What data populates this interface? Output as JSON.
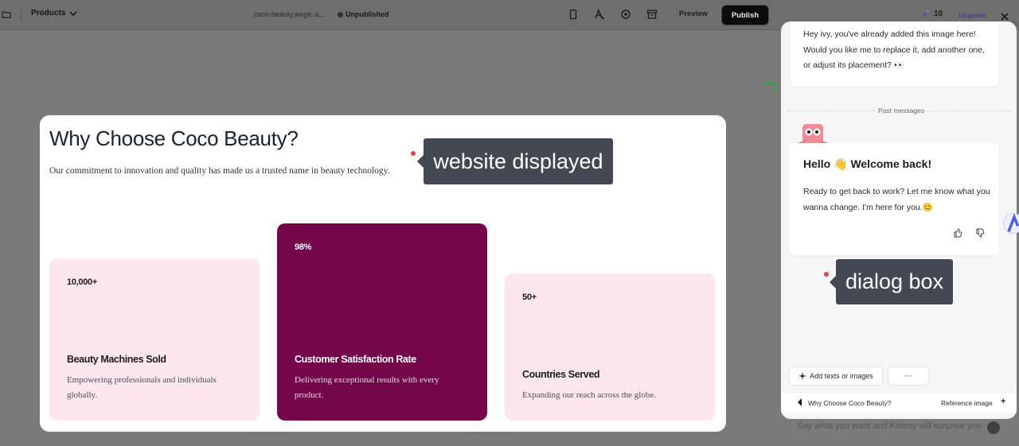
{
  "topbar": {
    "pages_label": "Products",
    "site_url": "coco-beauty.wegic.a...",
    "status": "Unpublished",
    "preview_label": "Preview",
    "publish_label": "Publish",
    "credits": "10",
    "upgrade_label": "Upgrade",
    "tool_icons": [
      "mobile-icon",
      "text-style-icon",
      "settings-icon",
      "archive-icon"
    ]
  },
  "site": {
    "heading": "Why Choose Coco Beauty?",
    "subheading": "Our commitment to innovation and quality has made us a trusted name in beauty technology.",
    "cards": [
      {
        "number": "10,000+",
        "title": "Beauty Machines Sold",
        "description": "Empowering professionals and individuals globally.",
        "style": "light"
      },
      {
        "number": "98%",
        "title": "Customer Satisfaction Rate",
        "description": "Delivering exceptional results with every product.",
        "style": "dark"
      },
      {
        "number": "50+",
        "title": "Countries Served",
        "description": "Expanding our reach across the globe.",
        "style": "light"
      }
    ]
  },
  "annotations": {
    "website": "website displayed",
    "dialog": "dialog box"
  },
  "chat": {
    "prev_message": "Hey ivy, you've already added this image here! Would you like me to replace it, add another one, or adjust its placement? 👀",
    "past_messages_label": "Past messages",
    "welcome_title": "Hello 👋 Welcome back!",
    "welcome_body": "Ready to get back to work? Let me know what you wanna change. I'm here for you.😊",
    "add_button": "Add texts or images",
    "more_button": "···",
    "reference_question": "Why Choose Coco Beauty?",
    "reference_label": "Reference image",
    "reference_plus": "+",
    "composer_placeholder": "Say what you want and Kimmy will surprise you",
    "close_icon": "close-icon"
  },
  "colors": {
    "accent_dark_card": "#73074a",
    "light_card": "#fde6ec",
    "annotation_bg": "#434853",
    "annotation_dot": "#e0424a",
    "publish_bg": "#0c0c0c"
  }
}
